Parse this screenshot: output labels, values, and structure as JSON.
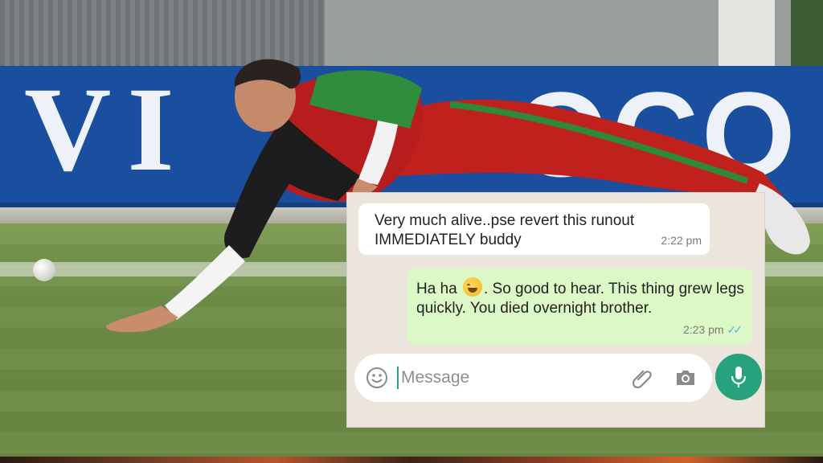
{
  "background": {
    "banner_left_text": "VI",
    "banner_right_text": "OCO"
  },
  "chat": {
    "incoming": {
      "text": "Very much alive..pse revert this runout IMMEDIATELY buddy",
      "time": "2:22 pm"
    },
    "outgoing": {
      "text_before_emoji": "Ha ha",
      "emoji": "face-with-tears-of-joy",
      "text_after_emoji": ".  So good to hear. This thing grew legs quickly. You died overnight brother.",
      "time": "2:23 pm",
      "status": "read"
    },
    "input": {
      "placeholder": "Message"
    },
    "colors": {
      "chat_bg": "#ece5dd",
      "incoming_bubble": "#ffffff",
      "outgoing_bubble": "#dcf8c6",
      "accent": "#26a37c",
      "read_ticks": "#4fb6ec"
    }
  }
}
